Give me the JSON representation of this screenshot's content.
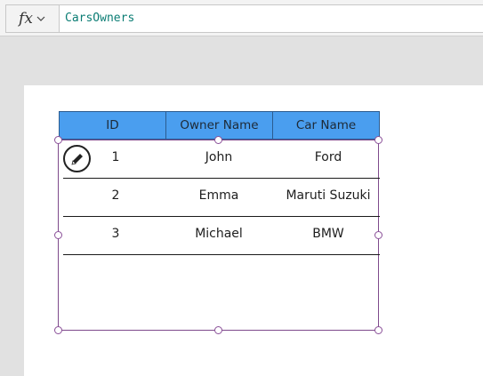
{
  "formula_bar": {
    "fx_label": "fx",
    "formula": "CarsOwners"
  },
  "table": {
    "columns": [
      "ID",
      "Owner Name",
      "Car Name"
    ],
    "rows": [
      {
        "id": "1",
        "owner": "John",
        "car": "Ford"
      },
      {
        "id": "2",
        "owner": "Emma",
        "car": "Maruti Suzuki"
      },
      {
        "id": "3",
        "owner": "Michael",
        "car": "BMW"
      }
    ]
  },
  "icons": {
    "edit": "pencil-icon",
    "dropdown": "chevron-down-icon"
  },
  "colors": {
    "header_bg": "#4a9eef",
    "selection": "#7e4a8c",
    "formula_text": "#0b7d74"
  }
}
